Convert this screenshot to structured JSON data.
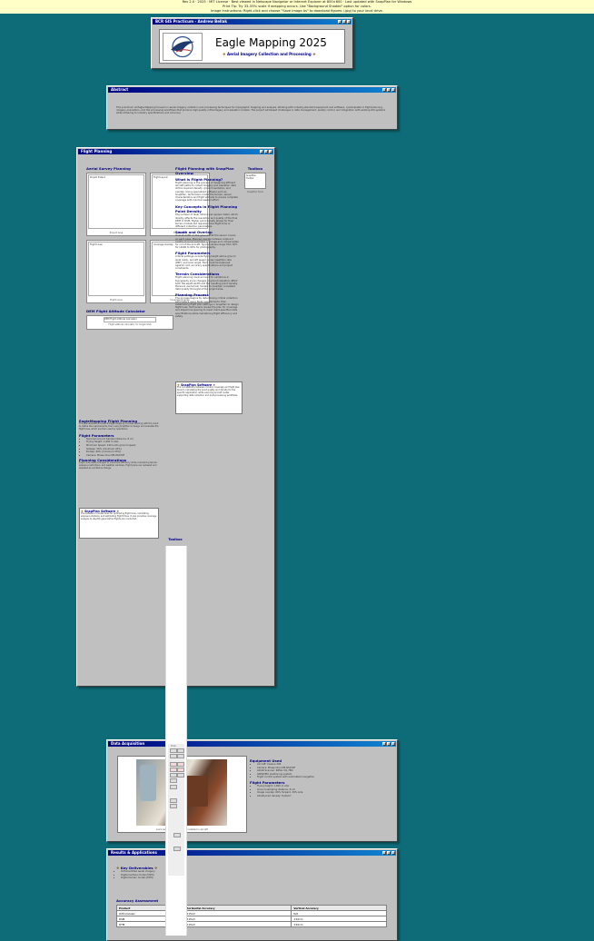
{
  "notice": {
    "line1": "Rev 2.0 · 2025 · MIT License · Best viewed in Netscape Navigator or Internet Explorer at 800×600 · Last updated with SnapPlan for Windows",
    "line2": "Print Tip: Try 33–55% scale if wrapping occurs. Use \"Background Shaded\" option for colors.",
    "line3": "Image Instructions: Right-click and choose \"Save Image As\" to download figures (.jpg) to your local drive."
  },
  "header_window": {
    "title": "BCR GIS Practicum - Andrew Bellak",
    "heading": "Eagle Mapping 2025",
    "subtitle": "Aerial Imagery Collection and Processing"
  },
  "abstract": {
    "title": "Abstract",
    "text": "This practicum at Eagle Mapping focused on aerial imagery collection and processing techniques for topographic mapping and analysis. Working with industry-standard equipment and software, I participated in flight planning, imagery acquisition, and the processing workflows that produce high-quality orthoimagery and elevation models. The project addressed challenges in data management, quality control, and integration with existing GIS systems while adhering to industry specifications and accuracy."
  },
  "flight_planning": {
    "title": "Flight Planning",
    "aerial_heading": "Aerial Survey Planning",
    "images": [
      {
        "alt": "Project Extent",
        "caption": "Project Area"
      },
      {
        "alt": "Flight Layout",
        "caption": "Flight Lines"
      },
      {
        "alt": "Flight Lines",
        "caption": "Flight Lines"
      },
      {
        "alt": "Coverage Overlap",
        "caption": "Coverage Overlap"
      }
    ],
    "calc_heading": "DEM Flight Altitude Calculator",
    "calc_alt": "DEM Flight Altitude Calculator",
    "calc_caption": "Flight altitude calculator for target GSD",
    "toolbox_heading": "Toolbox",
    "toolbox_alt": "SnapPlan Toolbar",
    "toolbox_caption": "SnapPlan Tools",
    "col_heading": "Flight Planning with SnapPlan Overview",
    "col_sub1": "What is Flight Planning?",
    "col_p1": "Flight planning is the process of designing efficient aircraft paths to collect imagery and elevation data at the required density, ground resolution, and overlap. Using specialized software such as SnapPlan, technicians model the terrain, sensor characteristics and flight altitude to ensure complete coverage with minimal wasted effort.",
    "col_sub2": "Key Concepts in Flight Planning",
    "col_sub3": "Point Density",
    "col_p3": "The number of laser returns per square meter, which directly affects the resolution and quality of the final DEM or DSM. Higher point density allows for finer terrain models but requires more flight time or different collection parameters.",
    "col_sub4": "Swath and Overlap",
    "col_p4": "Overall width on the ground that the sensor covers on each pass. Planned overlap between adjacent swaths ensures seamless coverage and compensates for roll of the aircraft. Typical values range from 30% for LiDAR to 60% for photography.",
    "col_sub5": "Flight Parameters",
    "col_p5": "Critical settings include flying height above ground level (AGL), aircraft speed, pulse repetition rate (PRF), and scan angle. Each must be balanced against cost, accuracy specifications and project constraints.",
    "col_sub6": "Terrain Considerations",
    "col_p6": "Flight planning must account for variations in topography since changes in ground elevation affect both the swath width and the resulting point density. Planners use terrain models to maintain consistent data quality throughout the project area.",
    "col_sub7": "Planning Process",
    "col_p7": "The process begins by determining critical collection parameters using flight requirements, then establishing flight plan settings in SnapPlan to design flight lines. Technicians review the plan for coverage and adjust line spacing to meet client-specified data specifications while maintaining flight efficiency and safety.",
    "snap_title": "SnapPlan Software",
    "snap_text": "The compatibility between modern coverage and flight plan tools to calculating the point quality and density for the specific application, while ensuring aircraft routes supporting data collection and post-processing workflows.",
    "em_heading": "EagleMapping Flight Planning",
    "em_text": "The standardized process at Eagle Mapping involves working with the client to define the requirements, then using SnapPlan to design and evaluate the flight lines, which are then used by operations.",
    "params_heading": "Flight Parameters",
    "params": [
      "Nominal Ground Sample Distance: 8 cm",
      "Flying Height: 1,800 m AGL",
      "Minimum Speed: 140 knots ground speed",
      "Sidelap: 30% (minimum 20%)",
      "Endlap: 60% (minimum 55%)",
      "Camera: Phase One iXM-RS150F"
    ],
    "consid_heading": "Planning Considerations",
    "consid_text": "Flight lines were arranged to maximize efficiency while considering terrain, airspace restrictions, and weather windows. Flight plans are reviewed and adjusted as conditions change.",
    "snap2_title": "SnapPlan Software",
    "snap2_text": "The software includes tools for optimizing flight lines, calculating exposure stations, and estimating flight times. It also provides coverage analysis to identify gaps before flights are conducted."
  },
  "toolbox_float": {
    "title": "Toolbox",
    "label": "Draw"
  },
  "data_acq": {
    "title": "Data Acquisition",
    "photo_caption": "Leica Aerial Camera System installed in aircraft",
    "equip_heading": "Equipment Used",
    "equipment": [
      "Aircraft: Cessna 206",
      "Camera: Phase One iXM-RS150F",
      "LiDAR Scanner: RIEGL VQ-780i",
      "GNSS/IMU positioning system",
      "Flight control system with automated navigation"
    ],
    "params_heading": "Flight Parameters",
    "params": [
      "Flying height: 1,800 m AGL",
      "Ground sampling distance: 8 cm",
      "Image overlap: 60% forward, 30% side",
      "LiDAR point density: 8 pts/m²"
    ]
  },
  "results": {
    "title": "Results & Applications",
    "deliv_heading": "Key Deliverables",
    "deliverables": [
      "Orthorectified aerial imagery",
      "Digital surface model (DSM)",
      "Digital terrain model (DTM)"
    ],
    "acc_heading": "Accuracy Assessment",
    "table_headers": [
      "Product",
      "Horizontal Accuracy",
      "Vertical Accuracy"
    ],
    "table_rows": [
      [
        "Orthomosaic",
        "±15cm",
        "N/A"
      ],
      [
        "DSM",
        "±15cm",
        "±10cm"
      ],
      [
        "DTM",
        "±15cm",
        "±10cm"
      ]
    ]
  },
  "colors": {
    "desktop": "#0e6c79",
    "window": "#c0c0c0",
    "titlebar": "#000080",
    "heading": "#000080"
  }
}
